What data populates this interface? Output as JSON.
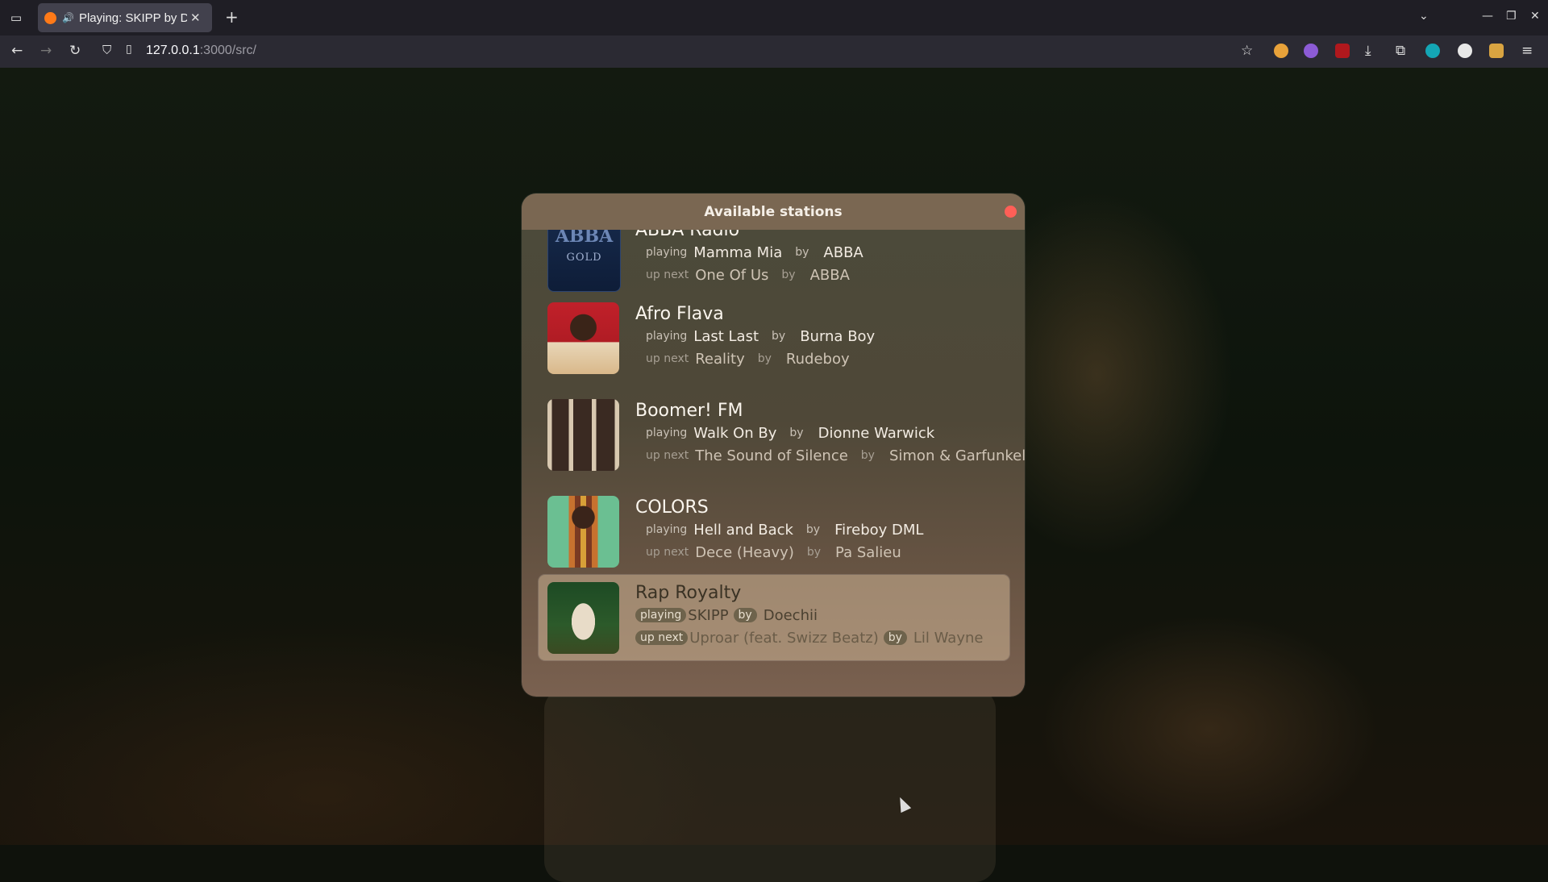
{
  "browser": {
    "tab_title": "Playing: SKIPP by Doechii",
    "url_host": "127.0.0.1",
    "url_rest": ":3000/src/"
  },
  "modal": {
    "title": "Available stations",
    "stations": [
      {
        "name": "ABBA Radio",
        "playing_label": "playing",
        "playing_song": "Mamma Mia",
        "by_label": "by",
        "playing_artist": "ABBA",
        "next_label": "up next",
        "next_song": "One Of Us",
        "next_artist": "ABBA",
        "active": false
      },
      {
        "name": "Afro Flava",
        "playing_label": "playing",
        "playing_song": "Last Last",
        "by_label": "by",
        "playing_artist": "Burna Boy",
        "next_label": "up next",
        "next_song": "Reality",
        "next_artist": "Rudeboy",
        "active": false
      },
      {
        "name": "Boomer! FM",
        "playing_label": "playing",
        "playing_song": "Walk On By",
        "by_label": "by",
        "playing_artist": "Dionne Warwick",
        "next_label": "up next",
        "next_song": "The Sound of Silence",
        "next_artist": "Simon & Garfunkel",
        "active": false
      },
      {
        "name": "COLORS",
        "playing_label": "playing",
        "playing_song": "Hell and Back",
        "by_label": "by",
        "playing_artist": "Fireboy DML",
        "next_label": "up next",
        "next_song": "Dece (Heavy)",
        "next_artist": "Pa Salieu",
        "active": false
      },
      {
        "name": "Rap Royalty",
        "playing_label": "playing",
        "playing_song": "SKIPP",
        "by_label": "by",
        "playing_artist": "Doechii",
        "next_label": "up next",
        "next_song": "Uproar (feat. Swizz Beatz)",
        "next_artist": "Lil Wayne",
        "active": true
      }
    ]
  },
  "art": {
    "abba_title": "ABBA",
    "abba_sub": "GOLD"
  },
  "colors": {
    "modal_header": "#7a6752",
    "close_button": "#ff5f57",
    "active_row": "#cdb496"
  }
}
